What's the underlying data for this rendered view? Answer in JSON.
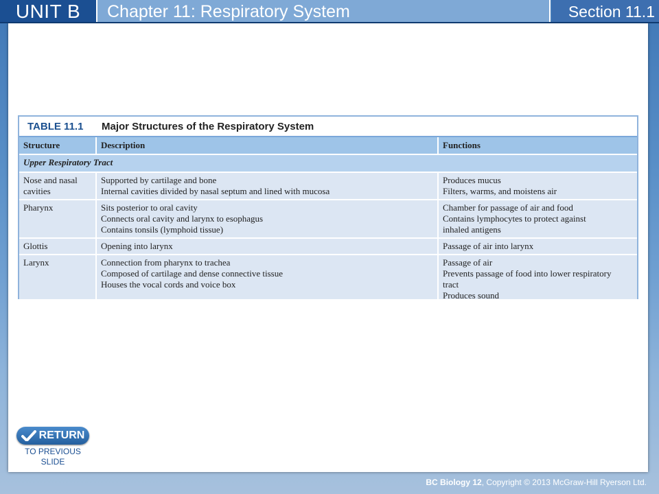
{
  "header": {
    "unit": "UNIT B",
    "chapter": "Chapter 11: Respiratory System",
    "section": "Section 11.1"
  },
  "table": {
    "number": "TABLE 11.1",
    "caption": "Major Structures of the Respiratory System",
    "columns": [
      "Structure",
      "Description",
      "Functions"
    ],
    "section_label": "Upper Respiratory Tract",
    "rows": [
      {
        "structure": [
          "Nose and nasal",
          "cavities"
        ],
        "description": [
          "Supported by cartilage and bone",
          "Internal cavities divided by nasal septum and lined with mucosa"
        ],
        "functions": [
          "Produces mucus",
          "Filters, warms, and moistens air"
        ]
      },
      {
        "structure": [
          "Pharynx"
        ],
        "description": [
          "Sits posterior to oral cavity",
          "Connects oral cavity and larynx to esophagus",
          "Contains tonsils (lymphoid tissue)"
        ],
        "functions": [
          "Chamber for passage of air and food",
          "Contains lymphocytes to protect against",
          "inhaled antigens"
        ]
      },
      {
        "structure": [
          "Glottis"
        ],
        "description": [
          "Opening into larynx"
        ],
        "functions": [
          "Passage of air into larynx"
        ]
      },
      {
        "structure": [
          "Larynx"
        ],
        "description": [
          "Connection from pharynx to trachea",
          "Composed of cartilage and dense connective tissue",
          "Houses the vocal cords and voice box"
        ],
        "functions": [
          "Passage of air",
          "Prevents passage of food into lower respiratory",
          "tract",
          "Produces sound"
        ]
      }
    ]
  },
  "return_button": {
    "label": "RETURN",
    "icon": "check-arrow-icon",
    "sub_line1": "TO PREVIOUS",
    "sub_line2": "SLIDE"
  },
  "footer": {
    "course": "BC Biology 12",
    "copyright": ", Copyright © 2013 McGraw-Hill Ryerson Ltd."
  },
  "colors": {
    "unit_bg": "#1b4f92",
    "chapter_bg": "#7fa9d6",
    "section_bg": "#3d6fb0",
    "table_header_bg": "#9ec4e8",
    "section_row_bg": "#b6d2ee"
  }
}
